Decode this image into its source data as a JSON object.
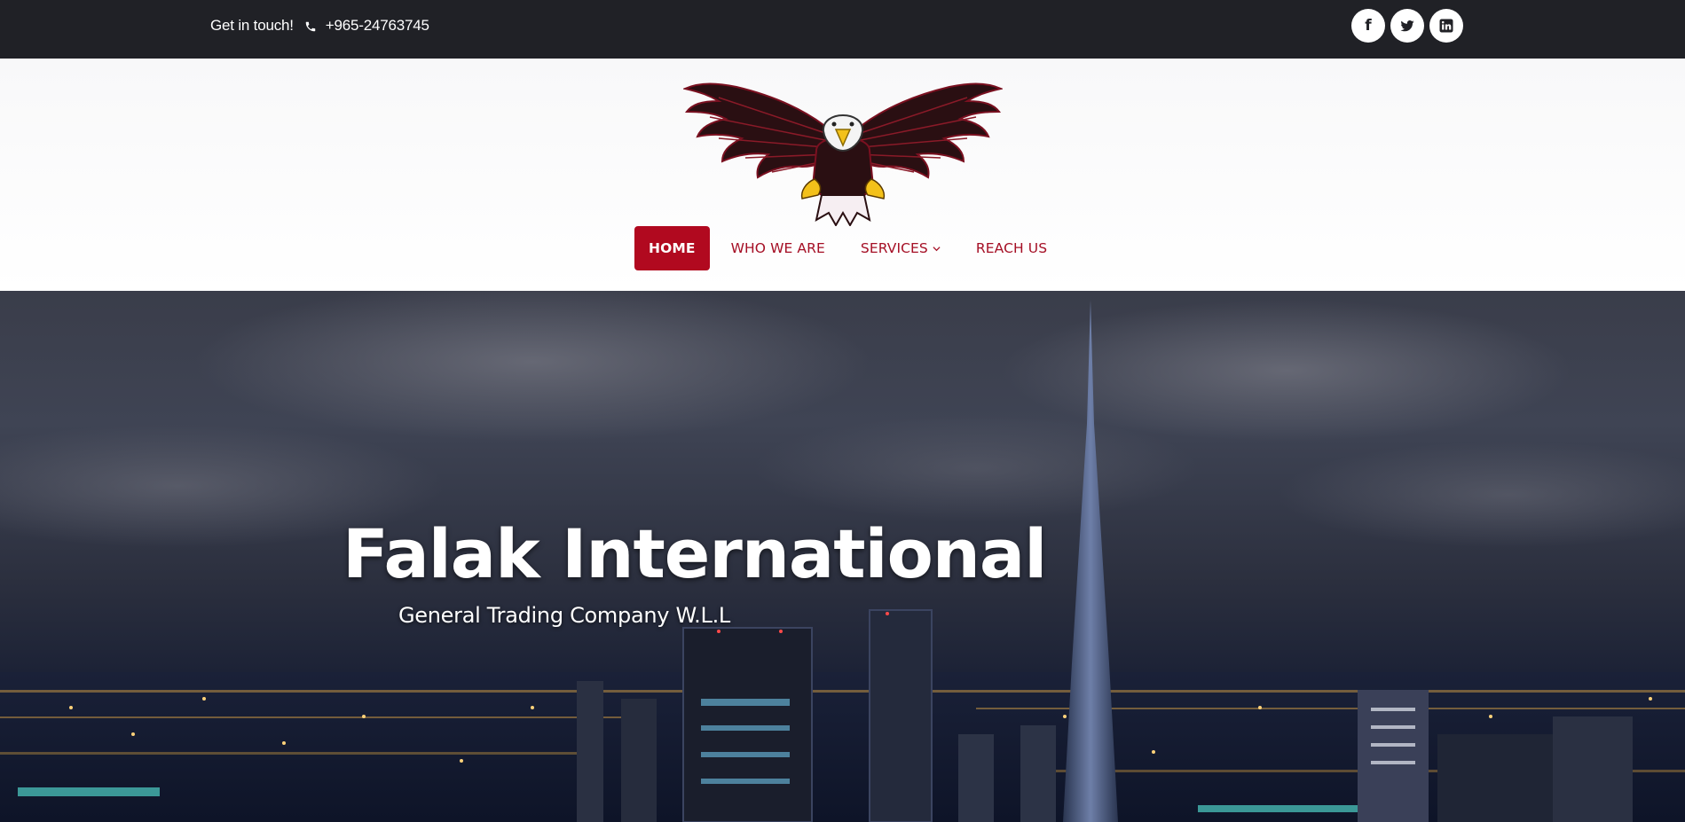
{
  "topbar": {
    "contact_label": "Get in touch!",
    "phone": "+965-24763745",
    "phone_icon": "phone-icon",
    "socials": [
      {
        "name": "facebook",
        "icon": "facebook-icon",
        "glyph": "f"
      },
      {
        "name": "twitter",
        "icon": "twitter-icon"
      },
      {
        "name": "linkedin",
        "icon": "linkedin-icon"
      }
    ]
  },
  "header": {
    "logo": "eagle-logo"
  },
  "nav": {
    "items": [
      {
        "label": "HOME",
        "active": true
      },
      {
        "label": "WHO WE ARE",
        "active": false
      },
      {
        "label": "SERVICES",
        "active": false,
        "has_dropdown": true
      },
      {
        "label": "REACH US",
        "active": false
      }
    ]
  },
  "hero": {
    "title": "Falak International",
    "subtitle": "General Trading Company W.L.L"
  },
  "colors": {
    "topbar_bg": "#202126",
    "accent": "#b1091f",
    "nav_text": "#a50f25"
  }
}
